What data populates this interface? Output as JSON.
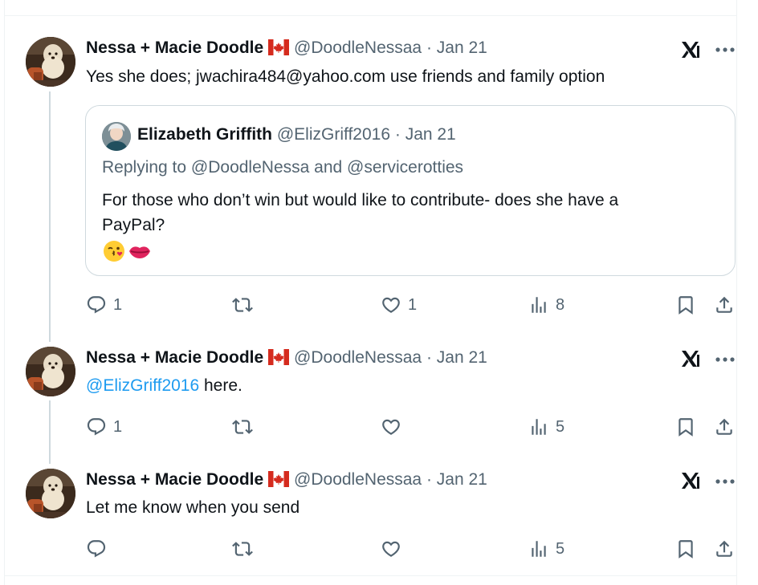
{
  "colors": {
    "accent": "#1d9bf0",
    "muted": "#536471",
    "text": "#0f1419",
    "border": "#cfd9de"
  },
  "icons": {
    "flag": "canada-flag-icon",
    "grok": "grok-icon",
    "more": "more-dots-icon",
    "reply": "reply-icon",
    "repost": "repost-icon",
    "like": "heart-icon",
    "views": "views-bar-chart-icon",
    "bookmark": "bookmark-icon",
    "share": "share-icon"
  },
  "tweets": [
    {
      "name": "Nessa + Macie Doodle",
      "handle": "@DoodleNessaa",
      "dot": "·",
      "date": "Jan 21",
      "text": "Yes she does; jwachira484@yahoo.com use friends and family option",
      "quote": {
        "name": "Elizabeth Griffith",
        "handle": "@ElizGriff2016",
        "dot": "·",
        "date": "Jan 21",
        "replying_prefix": "Replying to",
        "replying_to_1": "@DoodleNessa",
        "replying_and": "and",
        "replying_to_2": "@servicerotties",
        "text_line1": "For those who don’t win but would like to contribute- does she have a",
        "text_line2": "PayPal?",
        "emojis": [
          "😘",
          "💋"
        ]
      },
      "replies": "1",
      "reposts": "",
      "likes": "1",
      "views": "8"
    },
    {
      "name": "Nessa + Macie Doodle",
      "handle": "@DoodleNessaa",
      "dot": "·",
      "date": "Jan 21",
      "mention": "@ElizGriff2016",
      "text": " here.",
      "replies": "1",
      "reposts": "",
      "likes": "",
      "views": "5"
    },
    {
      "name": "Nessa + Macie Doodle",
      "handle": "@DoodleNessaa",
      "dot": "·",
      "date": "Jan 21",
      "text": "Let me know when you send",
      "replies": "",
      "reposts": "",
      "likes": "",
      "views": "5"
    }
  ]
}
